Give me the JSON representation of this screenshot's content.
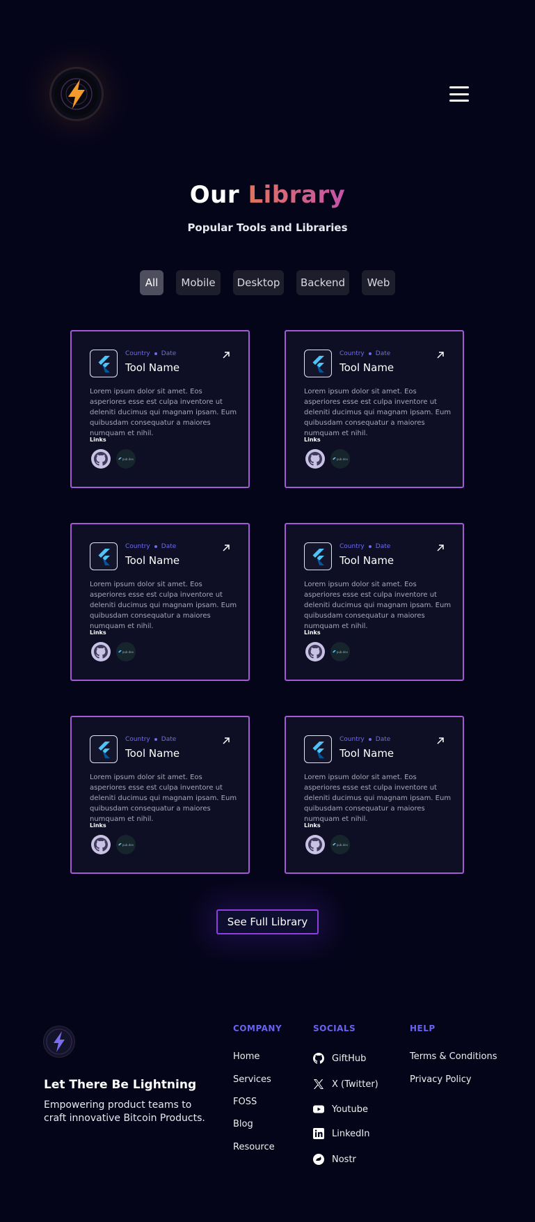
{
  "header": {
    "logo_alt": "lightning-logo",
    "menu_icon": "hamburger-menu-icon"
  },
  "hero": {
    "title_part1": "Our",
    "title_part2": "Library",
    "subtitle": "Popular Tools and Libraries"
  },
  "filters": [
    {
      "label": "All",
      "active": true
    },
    {
      "label": "Mobile",
      "active": false
    },
    {
      "label": "Desktop",
      "active": false
    },
    {
      "label": "Backend",
      "active": false
    },
    {
      "label": "Web",
      "active": false
    }
  ],
  "cards": [
    {
      "country": "Country",
      "date": "Date",
      "name": "Tool Name",
      "description": "Lorem ipsum dolor sit amet. Eos asperiores esse est culpa inventore ut deleniti ducimus qui magnam ipsam. Eum quibusdam consequatur a maiores numquam et nihil.",
      "links_label": "Links",
      "pub_label": "pub.dev"
    },
    {
      "country": "Country",
      "date": "Date",
      "name": "Tool Name",
      "description": "Lorem ipsum dolor sit amet. Eos asperiores esse est culpa inventore ut deleniti ducimus qui magnam ipsam. Eum quibusdam consequatur a maiores numquam et nihil.",
      "links_label": "Links",
      "pub_label": "pub.dev"
    },
    {
      "country": "Country",
      "date": "Date",
      "name": "Tool Name",
      "description": "Lorem ipsum dolor sit amet. Eos asperiores esse est culpa inventore ut deleniti ducimus qui magnam ipsam. Eum quibusdam consequatur a maiores numquam et nihil.",
      "links_label": "Links",
      "pub_label": "pub.dev"
    },
    {
      "country": "Country",
      "date": "Date",
      "name": "Tool Name",
      "description": "Lorem ipsum dolor sit amet. Eos asperiores esse est culpa inventore ut deleniti ducimus qui magnam ipsam. Eum quibusdam consequatur a maiores numquam et nihil.",
      "links_label": "Links",
      "pub_label": "pub.dev"
    },
    {
      "country": "Country",
      "date": "Date",
      "name": "Tool Name",
      "description": "Lorem ipsum dolor sit amet. Eos asperiores esse est culpa inventore ut deleniti ducimus qui magnam ipsam. Eum quibusdam consequatur a maiores numquam et nihil.",
      "links_label": "Links",
      "pub_label": "pub.dev"
    },
    {
      "country": "Country",
      "date": "Date",
      "name": "Tool Name",
      "description": "Lorem ipsum dolor sit amet. Eos asperiores esse est culpa inventore ut deleniti ducimus qui magnam ipsam. Eum quibusdam consequatur a maiores numquam et nihil.",
      "links_label": "Links",
      "pub_label": "pub.dev"
    }
  ],
  "see_full_label": "See Full Library",
  "footer": {
    "tagline": "Let There Be Lightning",
    "description": "Empowering product teams to craft innovative Bitcoin Products.",
    "company": {
      "heading": "COMPANY",
      "links": [
        "Home",
        "Services",
        "FOSS",
        "Blog",
        "Resource"
      ]
    },
    "socials": {
      "heading": "SOCIALS",
      "links": [
        {
          "label": "GiftHub",
          "icon": "github-icon"
        },
        {
          "label": "X (Twitter)",
          "icon": "x-twitter-icon"
        },
        {
          "label": "Youtube",
          "icon": "youtube-icon"
        },
        {
          "label": "LinkedIn",
          "icon": "linkedin-icon"
        },
        {
          "label": "Nostr",
          "icon": "nostr-icon"
        }
      ]
    },
    "help": {
      "heading": "HELP",
      "links": [
        "Terms & Conditions",
        "Privacy Policy"
      ]
    }
  },
  "colors": {
    "background": "#05051a",
    "accent": "#6863ee",
    "card_border": "#a45ad4"
  }
}
